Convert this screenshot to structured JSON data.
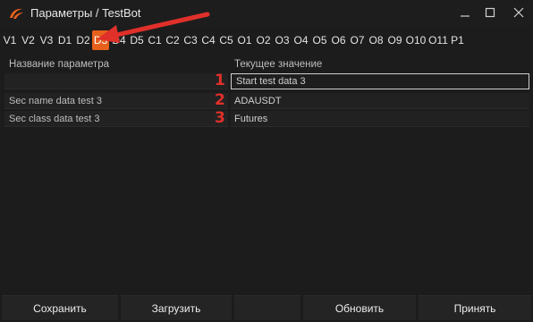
{
  "window": {
    "title": "Параметры / TestBot",
    "logo_icon": "app-logo-icon",
    "controls": [
      "minimize-icon",
      "maximize-icon",
      "close-icon"
    ]
  },
  "tabs": [
    {
      "label": "V1"
    },
    {
      "label": "V2"
    },
    {
      "label": "V3"
    },
    {
      "label": "D1"
    },
    {
      "label": "D2"
    },
    {
      "label": "D3",
      "active": true
    },
    {
      "label": "D4"
    },
    {
      "label": "D5"
    },
    {
      "label": "C1"
    },
    {
      "label": "C2"
    },
    {
      "label": "C3"
    },
    {
      "label": "C4"
    },
    {
      "label": "C5"
    },
    {
      "label": "O1"
    },
    {
      "label": "O2"
    },
    {
      "label": "O3"
    },
    {
      "label": "O4"
    },
    {
      "label": "O5"
    },
    {
      "label": "O6"
    },
    {
      "label": "O7"
    },
    {
      "label": "O8"
    },
    {
      "label": "O9"
    },
    {
      "label": "O10"
    },
    {
      "label": "O11"
    },
    {
      "label": "P1"
    }
  ],
  "grid": {
    "header": {
      "name": "Название параметра",
      "value": "Текущее значение"
    },
    "rows": [
      {
        "name": "",
        "value": "Start test data 3",
        "marker": "1",
        "editing": true
      },
      {
        "name": "Sec name data test 3",
        "value": "ADAUSDT",
        "marker": "2"
      },
      {
        "name": "Sec class data test 3",
        "value": "Futures",
        "marker": "3"
      }
    ]
  },
  "buttons": {
    "save": "Сохранить",
    "load": "Загрузить",
    "refresh": "Обновить",
    "accept": "Принять"
  },
  "colors": {
    "accent": "#e8611c",
    "annotation": "#e0302a",
    "background": "#1c1c1c"
  }
}
